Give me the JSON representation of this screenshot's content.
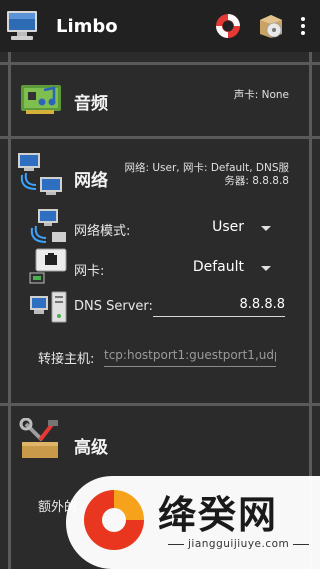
{
  "app": {
    "title": "Limbo"
  },
  "icons": {
    "app": "computer-icon",
    "help": "lifebuoy-icon",
    "package": "package-disc-icon",
    "menu": "overflow-menu-icon"
  },
  "audio": {
    "title": "音频",
    "info": "声卡: None"
  },
  "network": {
    "title": "网络",
    "info_line1": "网络: User, 网卡: Default, DNS服",
    "info_line2": "务器: 8.8.8.8",
    "mode_label": "网络模式:",
    "mode_value": "User",
    "nic_label": "网卡:",
    "nic_value": "Default",
    "dns_label": "DNS Server:",
    "dns_value": "8.8.8.8",
    "forward_label": "转接主机:",
    "forward_hint": "tcp:hostport1:guestport1,udp:"
  },
  "advanced": {
    "title": "高级",
    "extra_label": "额外的"
  },
  "watermark": {
    "text": "绛癸网",
    "url": "jiangguijiuye.com"
  }
}
